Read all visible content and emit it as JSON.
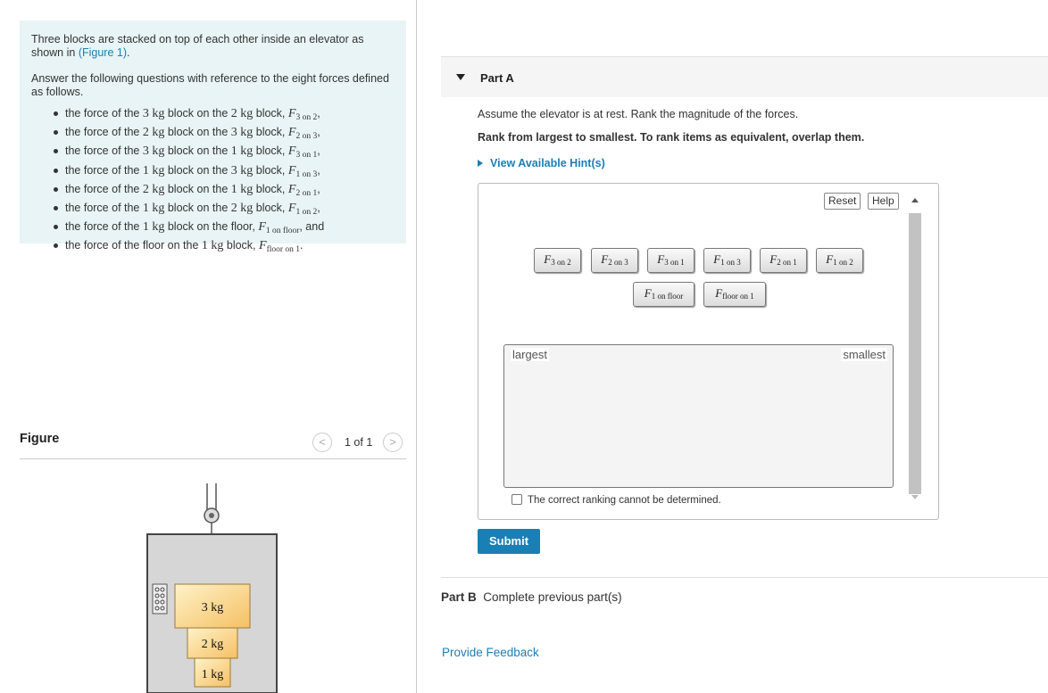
{
  "problem": {
    "intro_text": "Three blocks are stacked on top of each other inside an elevator as shown in",
    "figure_link": "(Figure 1)",
    "intro_end": ".",
    "answer_text": "Answer the following questions with reference to the eight forces defined as follows.",
    "forces": [
      {
        "pre": "the force of the",
        "m1": "3 kg",
        "mid": "block on the",
        "m2": "2 kg",
        "post": "block,",
        "sym": "F",
        "sub": "3 on 2",
        "end": ","
      },
      {
        "pre": "the force of the",
        "m1": "2 kg",
        "mid": "block on the",
        "m2": "3 kg",
        "post": "block,",
        "sym": "F",
        "sub": "2 on 3",
        "end": ","
      },
      {
        "pre": "the force of the",
        "m1": "3 kg",
        "mid": "block on the",
        "m2": "1 kg",
        "post": "block,",
        "sym": "F",
        "sub": "3 on 1",
        "end": ","
      },
      {
        "pre": "the force of the",
        "m1": "1 kg",
        "mid": "block on the",
        "m2": "3 kg",
        "post": "block,",
        "sym": "F",
        "sub": "1 on 3",
        "end": ","
      },
      {
        "pre": "the force of the",
        "m1": "2 kg",
        "mid": "block on the",
        "m2": "1 kg",
        "post": "block,",
        "sym": "F",
        "sub": "2 on 1",
        "end": ","
      },
      {
        "pre": "the force of the",
        "m1": "1 kg",
        "mid": "block on the",
        "m2": "2 kg",
        "post": "block,",
        "sym": "F",
        "sub": "1 on 2",
        "end": ","
      },
      {
        "pre": "the force of the",
        "m1": "1 kg",
        "mid": "block on the floor,",
        "m2": "",
        "post": "",
        "sym": "F",
        "sub": "1 on floor",
        "end": ", and"
      },
      {
        "pre": "the force of the floor on the",
        "m1": "1 kg",
        "mid": "block,",
        "m2": "",
        "post": "",
        "sym": "F",
        "sub": "floor on 1",
        "end": "."
      }
    ]
  },
  "figure": {
    "title": "Figure",
    "pager": "1 of 1",
    "prev_icon": "<",
    "next_icon": ">",
    "block_top": "3 kg",
    "block_mid": "2 kg",
    "block_bot": "1 kg"
  },
  "partA": {
    "title": "Part A",
    "prompt": "Assume the elevator is at rest. Rank the magnitude of the forces.",
    "instruction": "Rank from largest to smallest. To rank items as equivalent, overlap them.",
    "hint": "View Available Hint(s)",
    "reset": "Reset",
    "help": "Help",
    "tiles_row1": [
      {
        "sym": "F",
        "sub": "3 on 2"
      },
      {
        "sym": "F",
        "sub": "2 on 3"
      },
      {
        "sym": "F",
        "sub": "3 on 1"
      },
      {
        "sym": "F",
        "sub": "1 on 3"
      },
      {
        "sym": "F",
        "sub": "2 on 1"
      },
      {
        "sym": "F",
        "sub": "1 on 2"
      }
    ],
    "tiles_row2": [
      {
        "sym": "F",
        "sub": "1 on floor"
      },
      {
        "sym": "F",
        "sub": "floor on 1"
      }
    ],
    "largest": "largest",
    "smallest": "smallest",
    "cannot": "The correct ranking cannot be determined.",
    "submit": "Submit"
  },
  "partB": {
    "label": "Part B",
    "status": "Complete previous part(s)"
  },
  "feedback": "Provide Feedback"
}
